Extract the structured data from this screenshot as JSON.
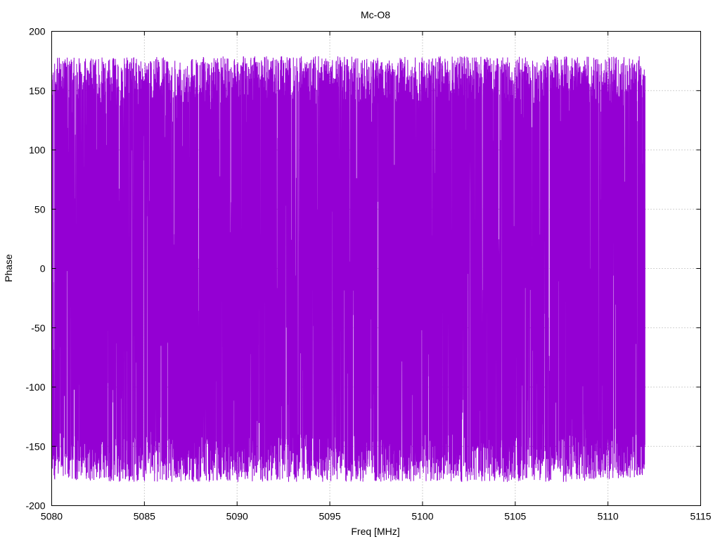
{
  "chart_data": {
    "type": "line",
    "title": "Mc-O8",
    "xlabel": "Freq [MHz]",
    "ylabel": "Phase",
    "xlim": [
      5080,
      5115
    ],
    "ylim": [
      -200,
      200
    ],
    "xticks": [
      5080,
      5085,
      5090,
      5095,
      5100,
      5105,
      5110,
      5115
    ],
    "yticks": [
      -200,
      -150,
      -100,
      -50,
      0,
      50,
      100,
      150,
      200
    ],
    "grid": true,
    "legend": "none",
    "series": [
      {
        "color": "#9400d3",
        "x_start": 5080,
        "x_end": 5112,
        "rendering": "dense oscillation between about -180 and 180 degrees",
        "envelope": {
          "x": [
            5080,
            5084,
            5088,
            5092,
            5096,
            5100,
            5104,
            5108,
            5112
          ],
          "upper": [
            178,
            178,
            179,
            179,
            179,
            179,
            179,
            179,
            179
          ],
          "lower": [
            -178,
            -180,
            -180,
            -180,
            -180,
            -180,
            -180,
            -180,
            -176
          ]
        }
      }
    ]
  }
}
